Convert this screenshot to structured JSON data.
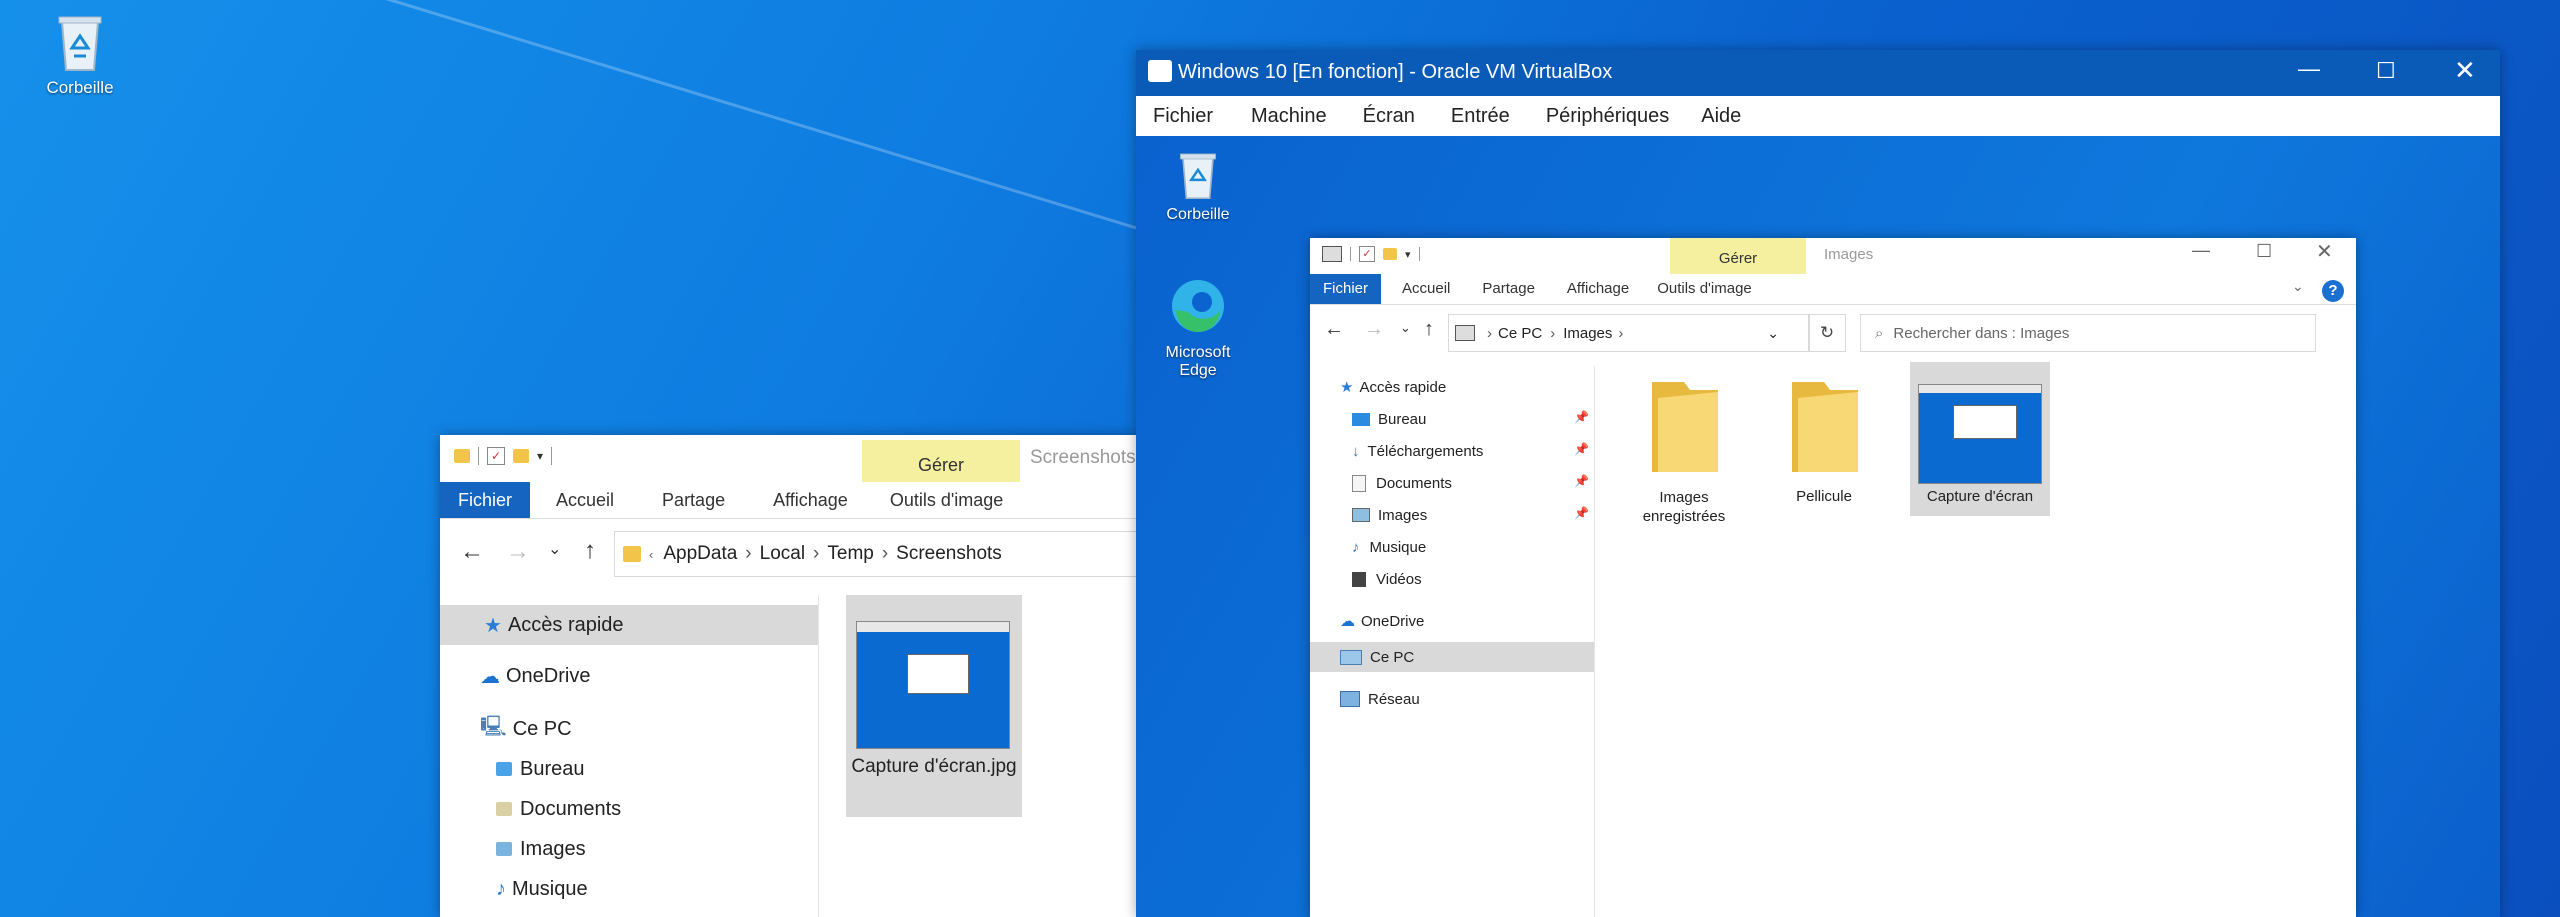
{
  "desktop": {
    "recycle_bin_label": "Corbeille"
  },
  "host_explorer": {
    "manage_label": "Gérer",
    "title_fragment": "Screenshots",
    "tabs": [
      "Fichier",
      "Accueil",
      "Partage",
      "Affichage",
      "Outils d'image"
    ],
    "breadcrumb": [
      "AppData",
      "Local",
      "Temp",
      "Screenshots"
    ],
    "nav": {
      "quick_access": "Accès rapide",
      "onedrive": "OneDrive",
      "this_pc": "Ce PC",
      "children": [
        "Bureau",
        "Documents",
        "Images",
        "Musique"
      ]
    },
    "file": {
      "name": "Capture d'écran.jpg"
    }
  },
  "vbox": {
    "title": "Windows 10 [En fonction] - Oracle VM VirtualBox",
    "menu": [
      "Fichier",
      "Machine",
      "Écran",
      "Entrée",
      "Périphériques",
      "Aide"
    ],
    "guest_desktop": {
      "recycle_bin_label": "Corbeille",
      "edge_label": "Microsoft Edge"
    },
    "guest_explorer": {
      "manage_label": "Gérer",
      "title": "Images",
      "tabs": [
        "Fichier",
        "Accueil",
        "Partage",
        "Affichage",
        "Outils d'image"
      ],
      "breadcrumb": [
        "Ce PC",
        "Images"
      ],
      "search_placeholder": "Rechercher dans : Images",
      "nav": {
        "quick_access": "Accès rapide",
        "items": [
          "Bureau",
          "Téléchargements",
          "Documents",
          "Images",
          "Musique",
          "Vidéos"
        ],
        "onedrive": "OneDrive",
        "this_pc": "Ce PC",
        "network": "Réseau"
      },
      "folders": [
        "Images enregistrées",
        "Pellicule",
        "Capture d'écran"
      ]
    }
  },
  "colors": {
    "accent": "#1464c0",
    "manage_bg": "#f4f0a0",
    "selection": "#d9d9d9"
  }
}
